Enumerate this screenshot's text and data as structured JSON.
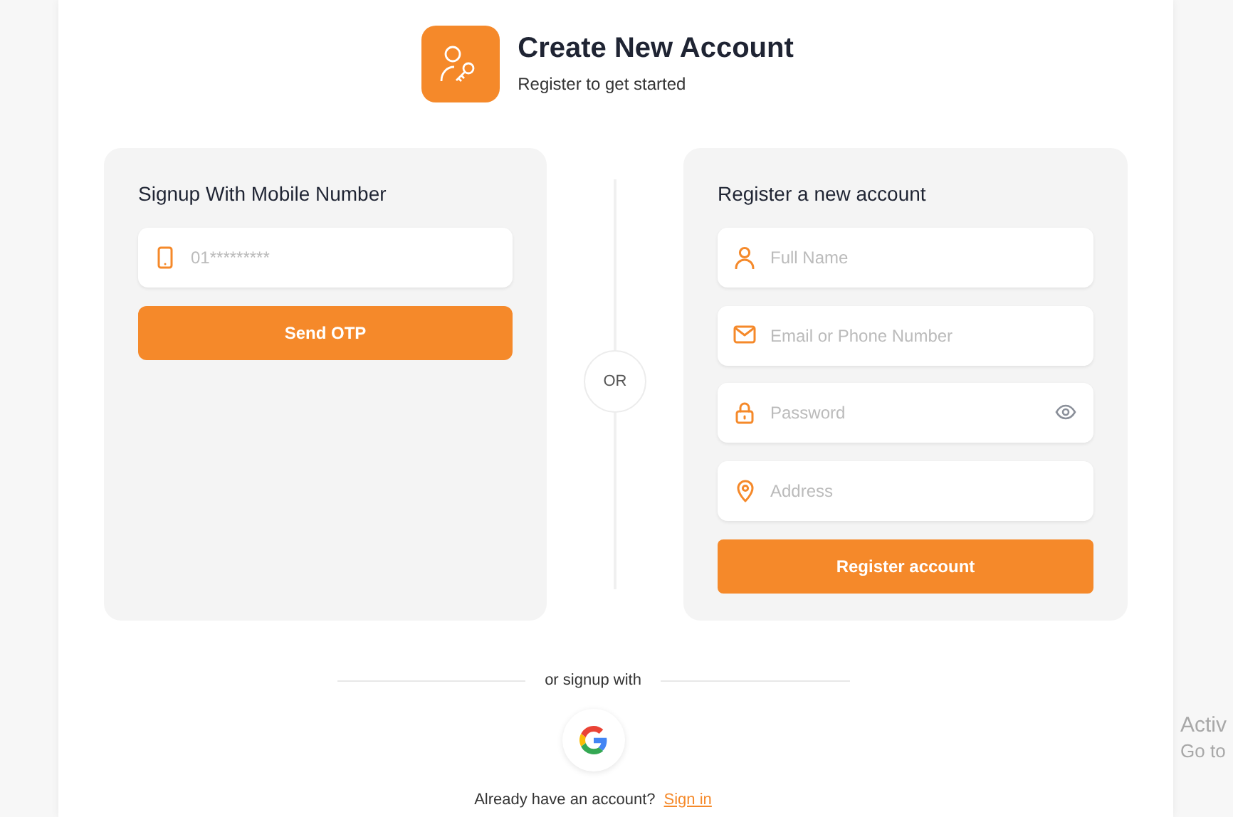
{
  "header": {
    "title": "Create New Account",
    "subtitle": "Register to get started"
  },
  "mobile_signup": {
    "title": "Signup With Mobile Number",
    "fields": [
      {
        "kind": "phone",
        "placeholder": "01*********"
      }
    ],
    "button": "Send OTP"
  },
  "separator": "OR",
  "register": {
    "title": "Register a new account",
    "fields": [
      {
        "kind": "person",
        "placeholder": "Full Name"
      },
      {
        "kind": "mail",
        "placeholder": "Email or Phone Number"
      },
      {
        "kind": "lock",
        "placeholder": "Password",
        "password_toggle": true
      },
      {
        "kind": "pin",
        "placeholder": "Address"
      }
    ],
    "button": "Register account"
  },
  "social": {
    "label": "or signup with",
    "providers": [
      {
        "kind": "google"
      }
    ]
  },
  "footer": {
    "text": "Already have an account?",
    "link": "Sign in"
  },
  "os_overlay": [
    "Activ",
    "Go to"
  ]
}
